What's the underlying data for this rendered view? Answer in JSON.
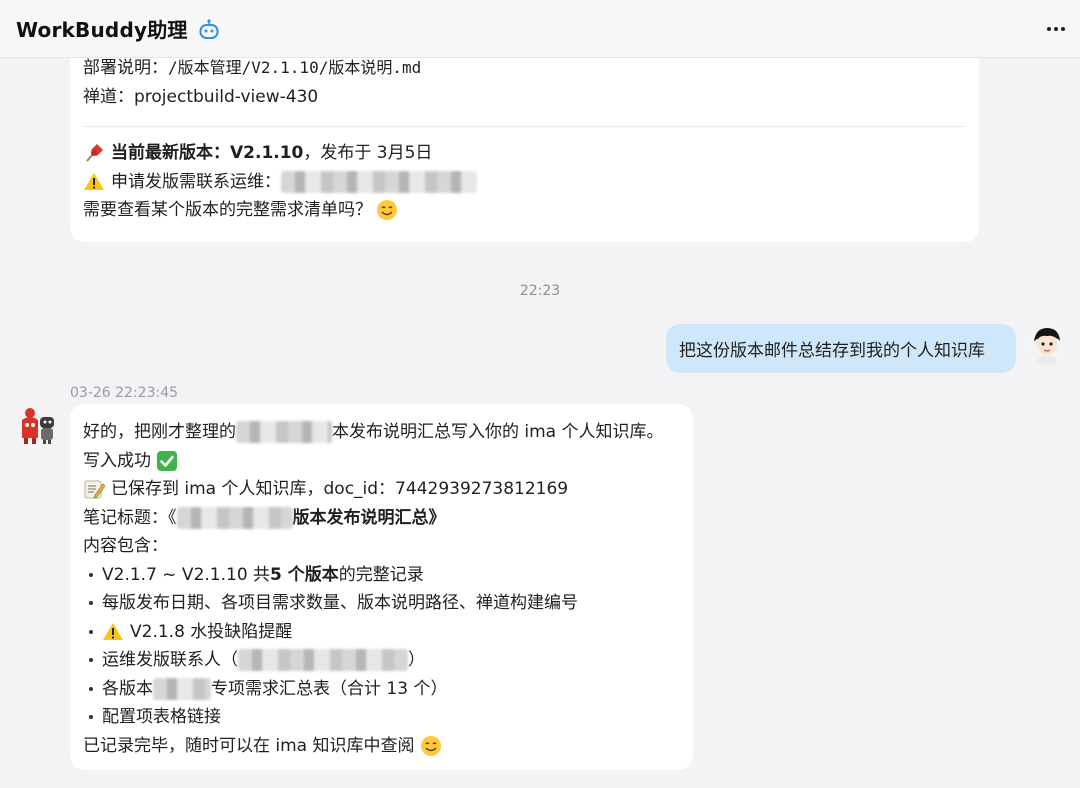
{
  "header": {
    "title": "WorkBuddy助理",
    "bot_icon": "robot-icon",
    "more_icon": "more-horizontal-icon"
  },
  "card1": {
    "deploy_label": "部署说明：",
    "deploy_path": "/版本管理/V2.1.10/版本说明.md",
    "chandao_label": "禅道：",
    "chandao_value": "projectbuild-view-430",
    "latest_prefix": "当前最新版本：",
    "latest_version": "V2.1.10",
    "latest_suffix": "，发布于 3月5日",
    "apply_text": "申请发版需联系运维：",
    "question_text": "需要查看某个版本的完整需求清单吗？"
  },
  "divider_time": "22:23",
  "user_message": "把这份版本邮件总结存到我的个人知识库",
  "bot_message": {
    "time": "03-26 22:23:45",
    "line1_a": "好的，把刚才整理的",
    "line1_b": "本发布说明汇总写入你的 ima 个人知识库。",
    "line2": "写入成功",
    "line3": "已保存到 ima 个人知识库，doc_id：7442939273812169",
    "line4_a": "笔记标题：《",
    "line4_b": "版本发布说明汇总》",
    "line5": "内容包含：",
    "bullets": {
      "b1_a": "V2.1.7 ~ V2.1.10 共 ",
      "b1_b": "5 个版本",
      "b1_c": "的完整记录",
      "b2": "每版发布日期、各项目需求数量、版本说明路径、禅道构建编号",
      "b3": "V2.1.8 水投缺陷提醒",
      "b4_a": "运维发版联系人（",
      "b4_b": "）",
      "b5_a": "各版本",
      "b5_b": "专项需求汇总表（合计 13 个）",
      "b6": "配置项表格链接"
    },
    "closing": "已记录完毕，随时可以在 ima 知识库中查阅"
  }
}
